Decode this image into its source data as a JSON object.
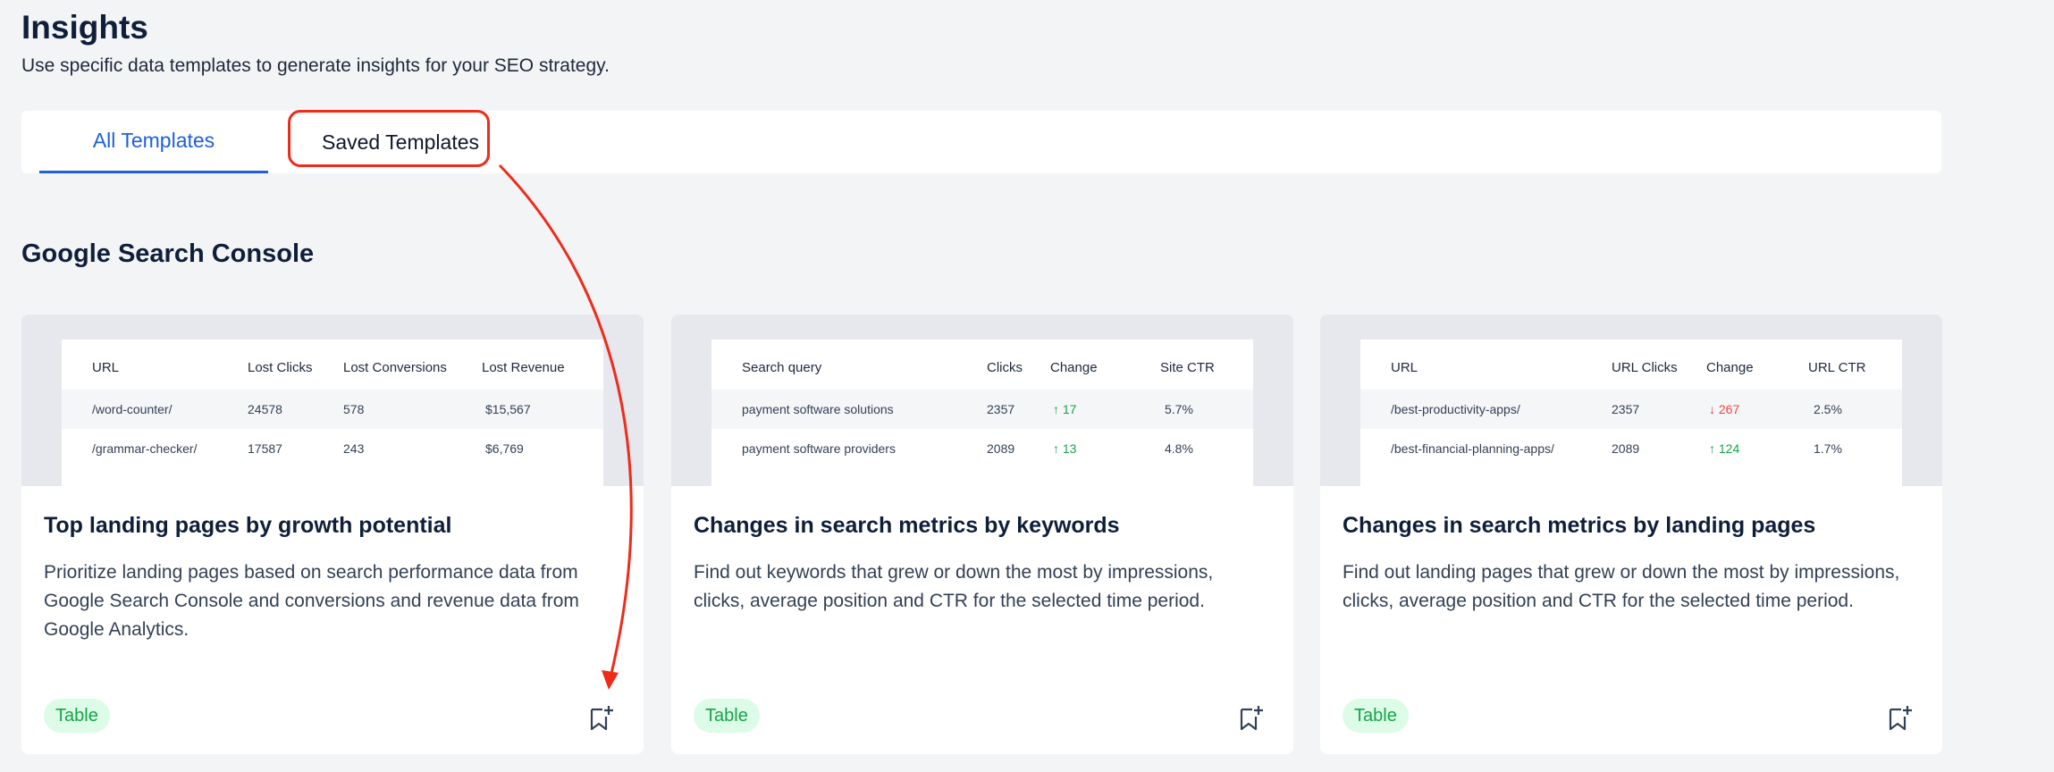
{
  "header": {
    "title": "Insights",
    "subtitle": "Use specific data templates to generate insights for your SEO strategy."
  },
  "tabs": [
    {
      "label": "All Templates",
      "active": true
    },
    {
      "label": "Saved Templates",
      "active": false
    }
  ],
  "section": {
    "title": "Google Search Console"
  },
  "cards": [
    {
      "preview": {
        "headers": [
          "URL",
          "Lost Clicks",
          "Lost Conversions",
          "Lost Revenue"
        ],
        "rows": [
          [
            "/word-counter/",
            "24578",
            "578",
            "$15,567"
          ],
          [
            "/grammar-checker/",
            "17587",
            "243",
            "$6,769"
          ]
        ]
      },
      "title": "Top landing pages by growth potential",
      "description": "Prioritize landing pages based on search performance data from Google Search Console and conversions and revenue data from Google Analytics.",
      "badge": "Table"
    },
    {
      "preview": {
        "headers": [
          "Search query",
          "Clicks",
          "Change",
          "Site CTR"
        ],
        "rows": [
          [
            "payment software solutions",
            "2357",
            "↑ 17",
            "5.7%"
          ],
          [
            "payment software providers",
            "2089",
            "↑ 13",
            "4.8%"
          ]
        ]
      },
      "title": "Changes in search metrics by keywords",
      "description": "Find out keywords that grew or down the most by impressions, clicks, average position and CTR for the selected time period.",
      "badge": "Table"
    },
    {
      "preview": {
        "headers": [
          "URL",
          "URL Clicks",
          "Change",
          "URL CTR"
        ],
        "rows": [
          [
            "/best-productivity-apps/",
            "2357",
            "↓ 267",
            "2.5%"
          ],
          [
            "/best-financial-planning-apps/",
            "2089",
            "↑ 124",
            "1.7%"
          ]
        ]
      },
      "title": "Changes in search metrics by landing pages",
      "description": "Find out landing pages that grew or down the most by impressions, clicks, average position and CTR for the selected time period.",
      "badge": "Table"
    }
  ],
  "icons": {
    "bookmark": "bookmark-add-icon",
    "annotation": "red-arrow-annotation"
  },
  "colors": {
    "accent": "#1d5fe0",
    "badge_bg": "#dcfce7",
    "badge_text": "#16a34a",
    "annotation": "#ef2b1a",
    "down": "#ef4444"
  }
}
